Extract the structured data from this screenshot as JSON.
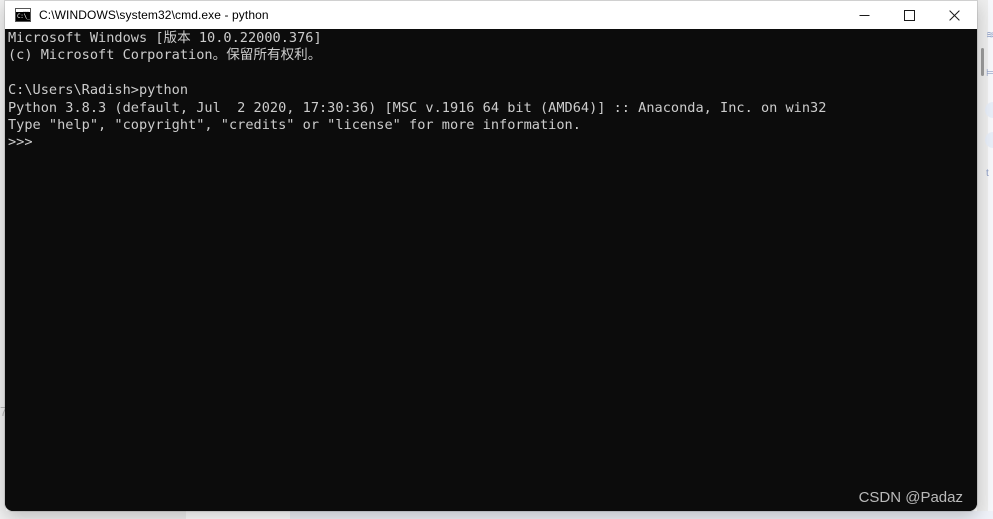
{
  "window": {
    "title": "C:\\WINDOWS\\system32\\cmd.exe - python",
    "icon": "cmd-console-icon",
    "icon_text": "C:\\_",
    "controls": {
      "minimize_label": "Minimize",
      "maximize_label": "Maximize",
      "close_label": "Close"
    },
    "background_color": "#0c0c0c",
    "text_color": "#cccccc",
    "titlebar_color": "#ffffff"
  },
  "console": {
    "lines": [
      "Microsoft Windows [版本 10.0.22000.376]",
      "(c) Microsoft Corporation。保留所有权利。",
      "",
      "C:\\Users\\Radish>python",
      "Python 3.8.3 (default, Jul  2 2020, 17:30:36) [MSC v.1916 64 bit (AMD64)] :: Anaconda, Inc. on win32",
      "Type \"help\", \"copyright\", \"credits\" or \"license\" for more information.",
      ">>>"
    ],
    "text": "Microsoft Windows [版本 10.0.22000.376]\n(c) Microsoft Corporation。保留所有权利。\n\nC:\\Users\\Radish>python\nPython 3.8.3 (default, Jul  2 2020, 17:30:36) [MSC v.1916 64 bit (AMD64)] :: Anaconda, Inc. on win32\nType \"help\", \"copyright\", \"credits\" or \"license\" for more information.\n>>>",
    "prompt": ">>>",
    "os_name": "Microsoft Windows",
    "os_version": "10.0.22000.376",
    "copyright": "(c) Microsoft Corporation。保留所有权利。",
    "user_path": "C:\\Users\\Radish",
    "command": "python",
    "python_version": "3.8.3",
    "python_build_date": "Jul  2 2020, 17:30:36",
    "python_compiler": "MSC v.1916 64 bit (AMD64)",
    "python_distribution": "Anaconda, Inc.",
    "python_platform": "win32"
  },
  "watermark": {
    "text": "CSDN @Padaz"
  },
  "background": {
    "left_glyph": "7",
    "right_fragment_a": "≋",
    "right_fragment_b": "⊨",
    "right_fragment_c": "t"
  }
}
